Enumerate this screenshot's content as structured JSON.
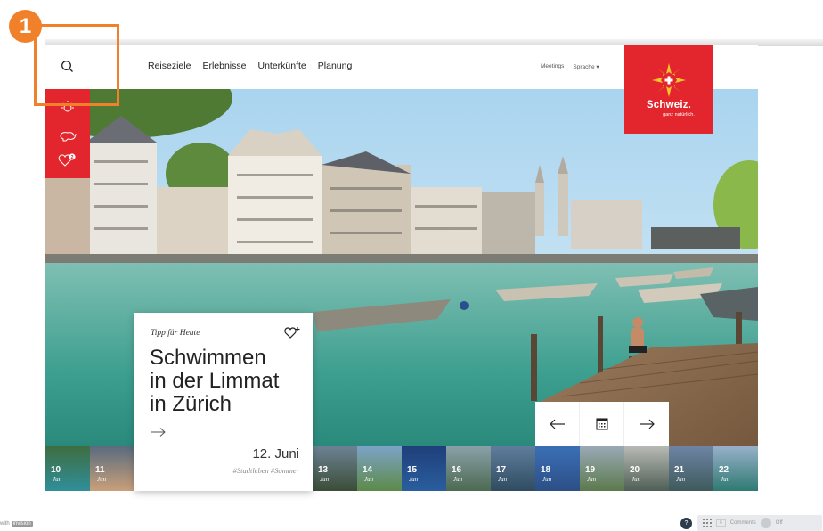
{
  "nav": {
    "links": [
      "Reiseziele",
      "Erlebnisse",
      "Unterkünfte",
      "Planung"
    ],
    "meetings": "Meetings",
    "language": "Sprache ▾"
  },
  "logo": {
    "brand": "Schweiz.",
    "slogan": "ganz natürlich."
  },
  "card": {
    "eyebrow": "Tipp für Heute",
    "title_lines": [
      "Schwimmen",
      "in der Limmat",
      "in Zürich"
    ],
    "date": "12. Juni",
    "tags": "#Stadtleben #Sommer"
  },
  "sidebar": {
    "favorites_count": "2"
  },
  "thumbnails": [
    {
      "day": "10",
      "month": "Jun"
    },
    {
      "day": "11",
      "month": "Jun"
    },
    {
      "day": "13",
      "month": "Jun"
    },
    {
      "day": "14",
      "month": "Jun"
    },
    {
      "day": "15",
      "month": "Jun"
    },
    {
      "day": "16",
      "month": "Jun"
    },
    {
      "day": "17",
      "month": "Jun"
    },
    {
      "day": "18",
      "month": "Jun"
    },
    {
      "day": "19",
      "month": "Jun"
    },
    {
      "day": "20",
      "month": "Jun"
    },
    {
      "day": "21",
      "month": "Jun"
    },
    {
      "day": "22",
      "month": "Jun"
    }
  ],
  "annotation": {
    "number": "1"
  },
  "footer": {
    "left_text": "with",
    "brand": "invision",
    "help": "?",
    "comments": "Comments",
    "pager": "6",
    "toggle": "Off"
  },
  "colors": {
    "brand_red": "#e3262d",
    "annotation_orange": "#f0812a"
  },
  "icons": [
    "search-icon",
    "sun-icon",
    "cow-icon",
    "heart-icon",
    "heart-plus-icon",
    "arrow-right-icon",
    "arrow-left-icon",
    "calendar-icon",
    "swiss-star-logo"
  ]
}
